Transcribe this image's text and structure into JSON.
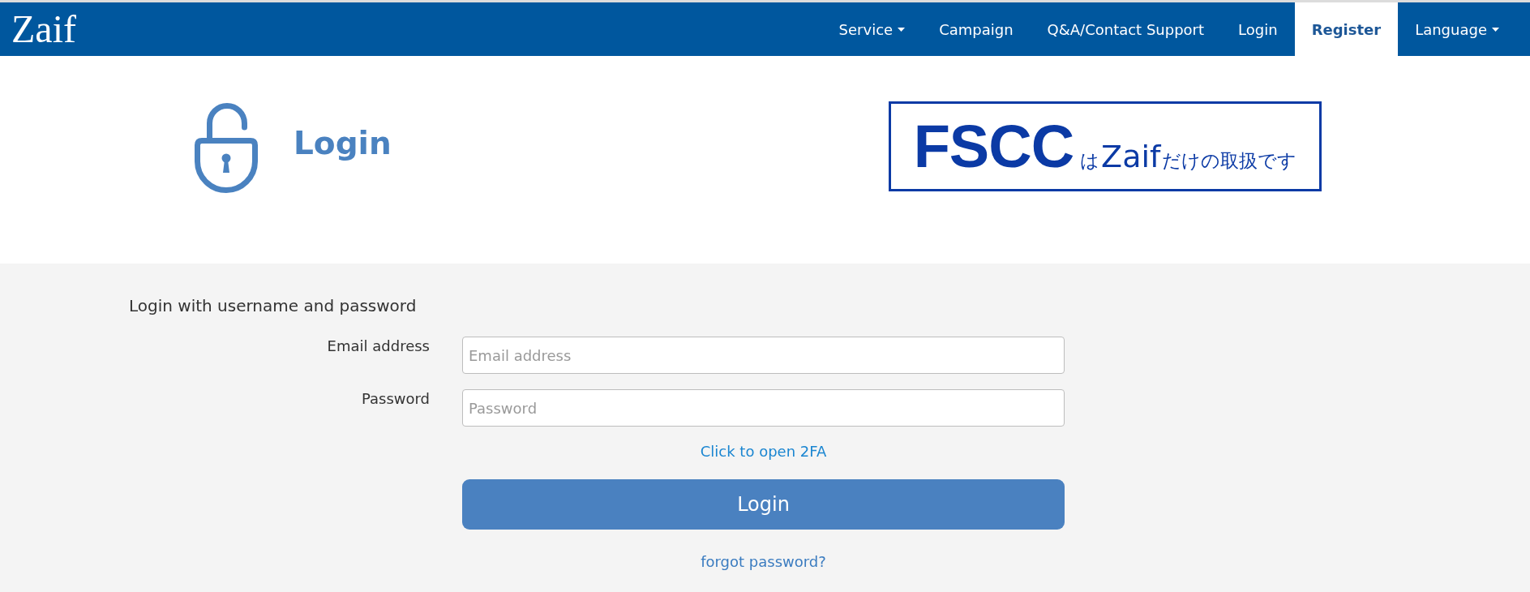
{
  "navbar": {
    "logo": "Zaif",
    "items": [
      {
        "label": "Service",
        "dropdown": true,
        "highlighted": false
      },
      {
        "label": "Campaign",
        "dropdown": false,
        "highlighted": false
      },
      {
        "label": "Q&A/Contact Support",
        "dropdown": false,
        "highlighted": false
      },
      {
        "label": "Login",
        "dropdown": false,
        "highlighted": false
      },
      {
        "label": "Register",
        "dropdown": false,
        "highlighted": true
      },
      {
        "label": "Language",
        "dropdown": true,
        "highlighted": false
      }
    ]
  },
  "header": {
    "title": "Login",
    "banner": {
      "headline": "FSCC",
      "parts": [
        {
          "text": "は",
          "kind": "small"
        },
        {
          "text": "Zaif",
          "kind": "large"
        },
        {
          "text": "だけの取扱です",
          "kind": "small"
        }
      ]
    }
  },
  "form": {
    "heading": "Login with username and password",
    "fields": [
      {
        "label": "Email address",
        "placeholder": "Email address"
      },
      {
        "label": "Password",
        "placeholder": "Password"
      }
    ],
    "twofa_link": "Click to open 2FA",
    "submit": "Login",
    "forgot_link": "forgot password?"
  }
}
